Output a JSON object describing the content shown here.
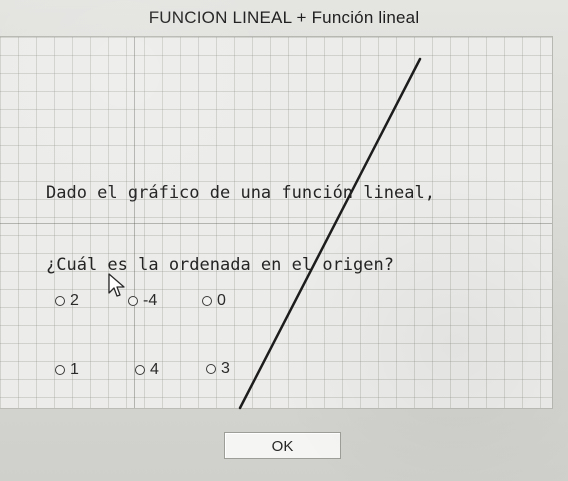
{
  "window": {
    "title": "FUNCION LINEAL + Función lineal"
  },
  "question": {
    "line1": "Dado el gráfico de una función lineal,",
    "line2": "¿Cuál es la ordenada en el origen?"
  },
  "options": [
    {
      "label": "2"
    },
    {
      "label": "-4"
    },
    {
      "label": "0"
    },
    {
      "label": "1"
    },
    {
      "label": "4"
    },
    {
      "label": "3"
    }
  ],
  "actions": {
    "ok_label": "OK"
  },
  "colors": {
    "graph_line": "#1d1d1d",
    "grid": "#b3b3ad"
  },
  "icons": {
    "cursor": "pointer-cursor-icon",
    "radio": "radio-button-icon"
  }
}
